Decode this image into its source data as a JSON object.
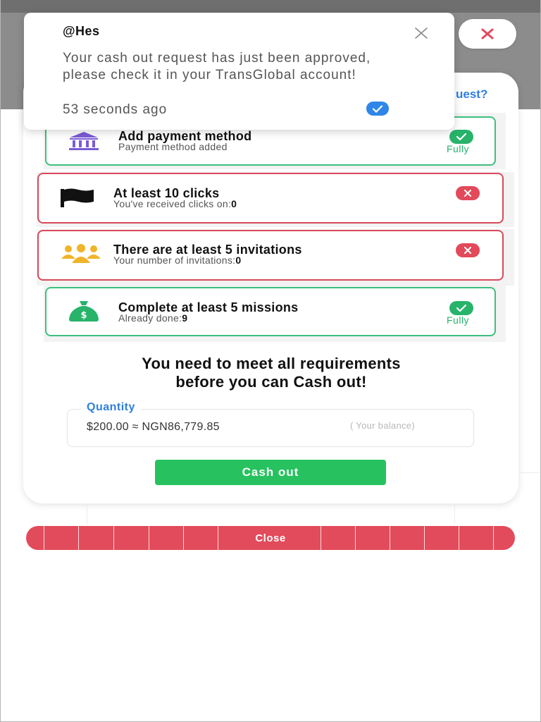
{
  "colors": {
    "success": "#27b36a",
    "danger": "#e2495b",
    "accent": "#2f7fe0",
    "button": "#27c25f",
    "icon_bank": "#7b5bd6",
    "icon_people": "#f0b429"
  },
  "header": {
    "help_link_partial": "uest?",
    "close_icon": "close-x-icon"
  },
  "notification": {
    "user": "@Hes",
    "message": "Your cash out request has just been approved, please check it in your TransGlobal account!",
    "time_ago": "53 seconds ago",
    "close_icon": "close-icon",
    "check_icon": "check-icon"
  },
  "requirements": [
    {
      "icon": "bank-icon",
      "title": "Add payment method",
      "subtitle_prefix": "Payment method added",
      "subtitle_value": "",
      "status": "ok",
      "status_label": "Fully"
    },
    {
      "icon": "flag-icon",
      "title": "At least 10 clicks",
      "subtitle_prefix": "You've received clicks on:",
      "subtitle_value": "0",
      "status": "fail",
      "status_label": ""
    },
    {
      "icon": "people-icon",
      "title": "There are at least 5 invitations",
      "subtitle_prefix": "Your number of invitations:",
      "subtitle_value": "0",
      "status": "fail",
      "status_label": ""
    },
    {
      "icon": "money-bag-icon",
      "title": "Complete at least 5 missions",
      "subtitle_prefix": "Already done:",
      "subtitle_value": "9",
      "status": "ok",
      "status_label": "Fully"
    }
  ],
  "warning": {
    "line1": "You need to meet all requirements",
    "line2": "before you can Cash out!"
  },
  "quantity": {
    "legend": "Quantity",
    "value": "$200.00 ≈ NGN86,779.85",
    "hint": "( Your balance)"
  },
  "buttons": {
    "cash_out": "Cash out",
    "close": "Close"
  }
}
